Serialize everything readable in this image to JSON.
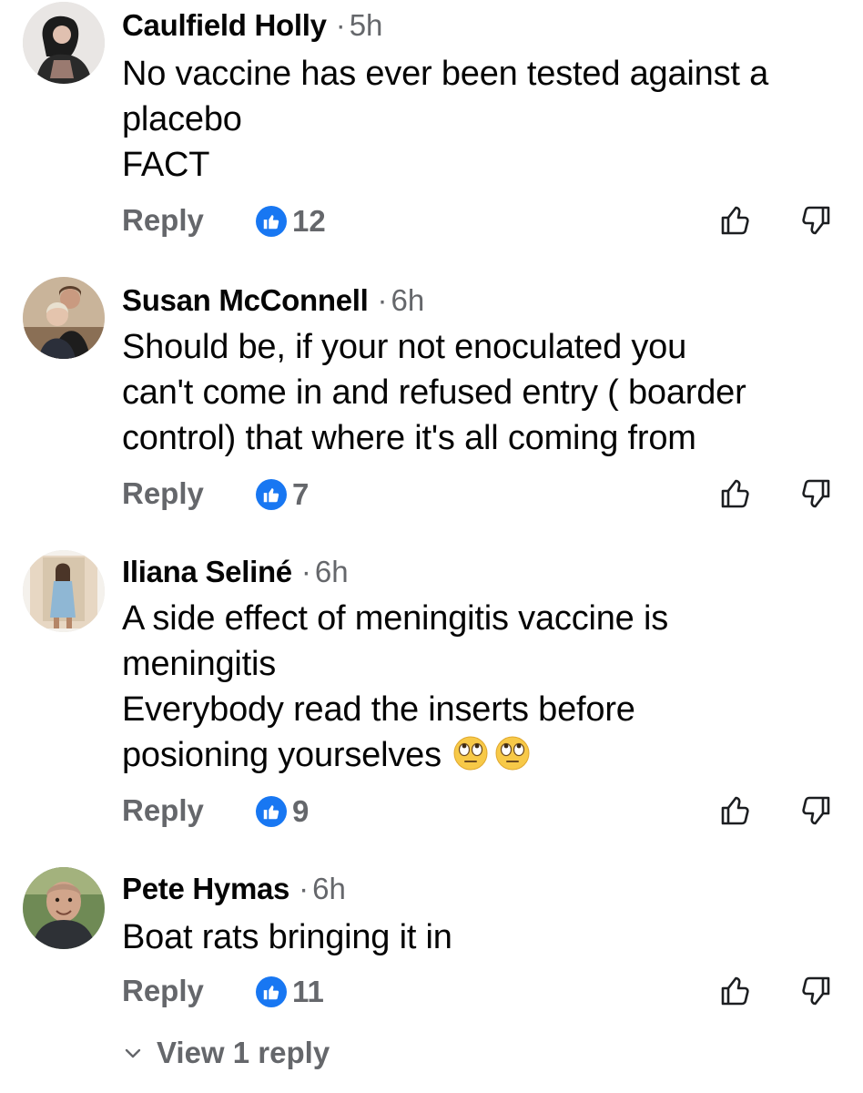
{
  "comments": [
    {
      "author": "Caulfield Holly",
      "time": "5h",
      "lines": [
        "No vaccine has ever been tested against a",
        "placebo",
        "FACT"
      ],
      "reply_label": "Reply",
      "like_count": "12"
    },
    {
      "author": "Susan McConnell",
      "time": "6h",
      "lines": [
        "Should be, if your not enoculated you",
        "can't come in and refused entry ( boarder",
        "control) that where it's all coming from"
      ],
      "reply_label": "Reply",
      "like_count": "7"
    },
    {
      "author": "Iliana Seliné",
      "time": "6h",
      "lines": [
        "A side effect of meningitis vaccine is",
        "meningitis",
        "Everybody read the inserts before",
        "posioning yourselves"
      ],
      "emojis": [
        "face-with-rolling-eyes",
        "face-with-rolling-eyes"
      ],
      "reply_label": "Reply",
      "like_count": "9"
    },
    {
      "author": "Pete Hymas",
      "time": "6h",
      "lines": [
        "Boat rats bringing it in"
      ],
      "reply_label": "Reply",
      "like_count": "11"
    }
  ],
  "view_replies_label": "View 1 reply",
  "colors": {
    "text": "#050505",
    "secondary": "#65676b",
    "like_blue": "#1877f2"
  }
}
